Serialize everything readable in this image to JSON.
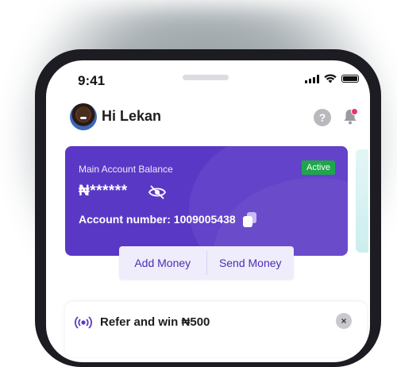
{
  "status_bar": {
    "time": "9:41"
  },
  "header": {
    "greeting": "Hi Lekan",
    "help_glyph": "?"
  },
  "balance_card": {
    "label": "Main Account Balance",
    "status_badge": "Active",
    "balance_masked": "₦******",
    "account_number": "Account number: 1009005438",
    "colors": {
      "card": "#5a38c6",
      "badge": "#1fa64a"
    }
  },
  "actions": {
    "add_money": "Add Money",
    "send_money": "Send Money"
  },
  "promo": {
    "text": "Refer and win ₦500",
    "close_glyph": "×"
  },
  "icons": [
    "avatar",
    "help-icon",
    "bell-icon",
    "eye-off-icon",
    "copy-icon",
    "broadcast-icon",
    "close-icon",
    "signal-icon",
    "wifi-icon",
    "battery-icon"
  ]
}
